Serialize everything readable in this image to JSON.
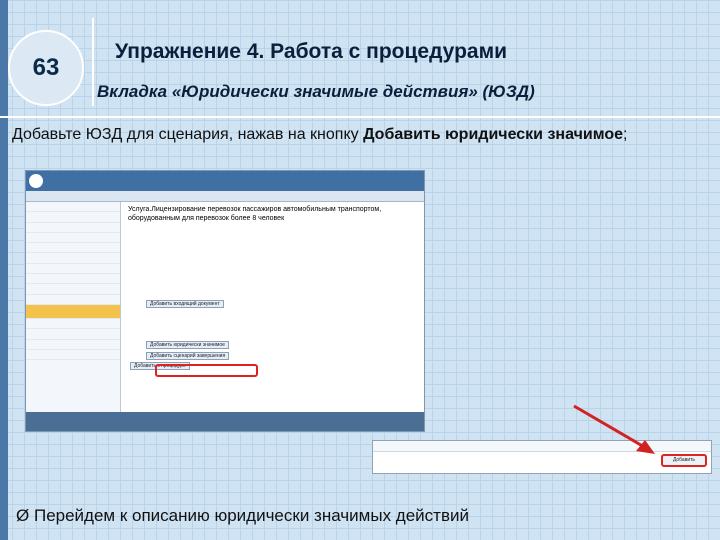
{
  "slide": {
    "number": "63",
    "title": "Упражнение 4. Работа с процедурами",
    "subtitle": "Вкладка «Юридически значимые действия» (ЮЗД)",
    "instruction_prefix": "Добавьте ЮЗД для сценария, нажав на кнопку ",
    "instruction_bold": "Добавить юридически значимое",
    "instruction_suffix": ";",
    "bullet_marker": "Ø",
    "bullet_text": "Перейдем к описанию юридически значимых действий"
  },
  "screenshot": {
    "main_title": "Услуга.Лицензирование перевозок пассажиров автомобильным транспортом, оборудованным для перевозок более 8 человек",
    "btn_add_input_doc": "Добавить входящий документ",
    "btn_add_legal_action": "Добавить юридически значимое",
    "btn_add_scenario": "Добавить сценарий завершения",
    "btn_add_step": "Добавить к процедуре"
  },
  "inset": {
    "button_label": "Добавить"
  },
  "colors": {
    "accent": "#3f6fa3",
    "highlight_red": "#d22222",
    "active_item": "#f3c24a"
  }
}
